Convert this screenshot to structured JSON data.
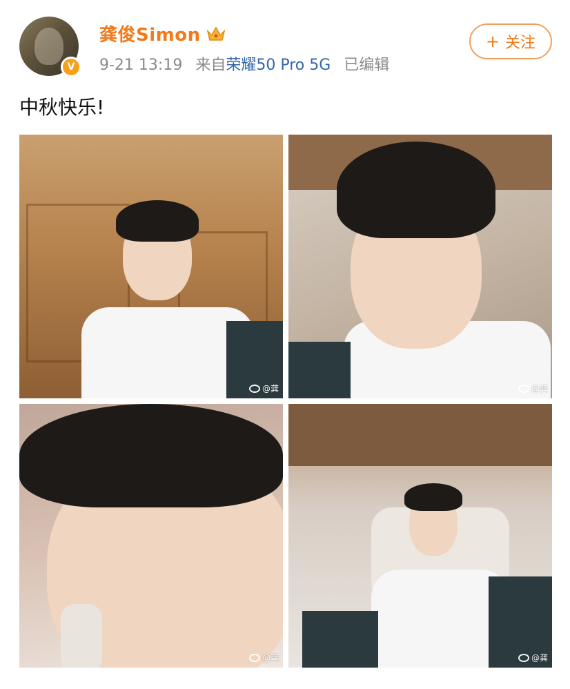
{
  "post": {
    "username": "龚俊Simon",
    "badge_icon": "verified-v-icon",
    "badge_label": "V",
    "crown_icon": "crown-icon",
    "timestamp": "9-21 13:19",
    "source_prefix": "来自",
    "device": "荣耀50 Pro 5G",
    "edited_label": "已编辑",
    "follow_button": {
      "icon": "plus-icon",
      "plus": "+",
      "label": "关注"
    },
    "text": "中秋快乐!",
    "photos": [
      {
        "watermark": "@龚"
      },
      {
        "watermark": "@龚"
      },
      {
        "watermark": "@龚"
      },
      {
        "watermark": "@龚"
      }
    ]
  },
  "colors": {
    "username": "#f27a1a",
    "device_link": "#3366aa",
    "meta_text": "#8a8a8a",
    "follow_border": "#f2a15c",
    "badge": "#f7a11a"
  }
}
